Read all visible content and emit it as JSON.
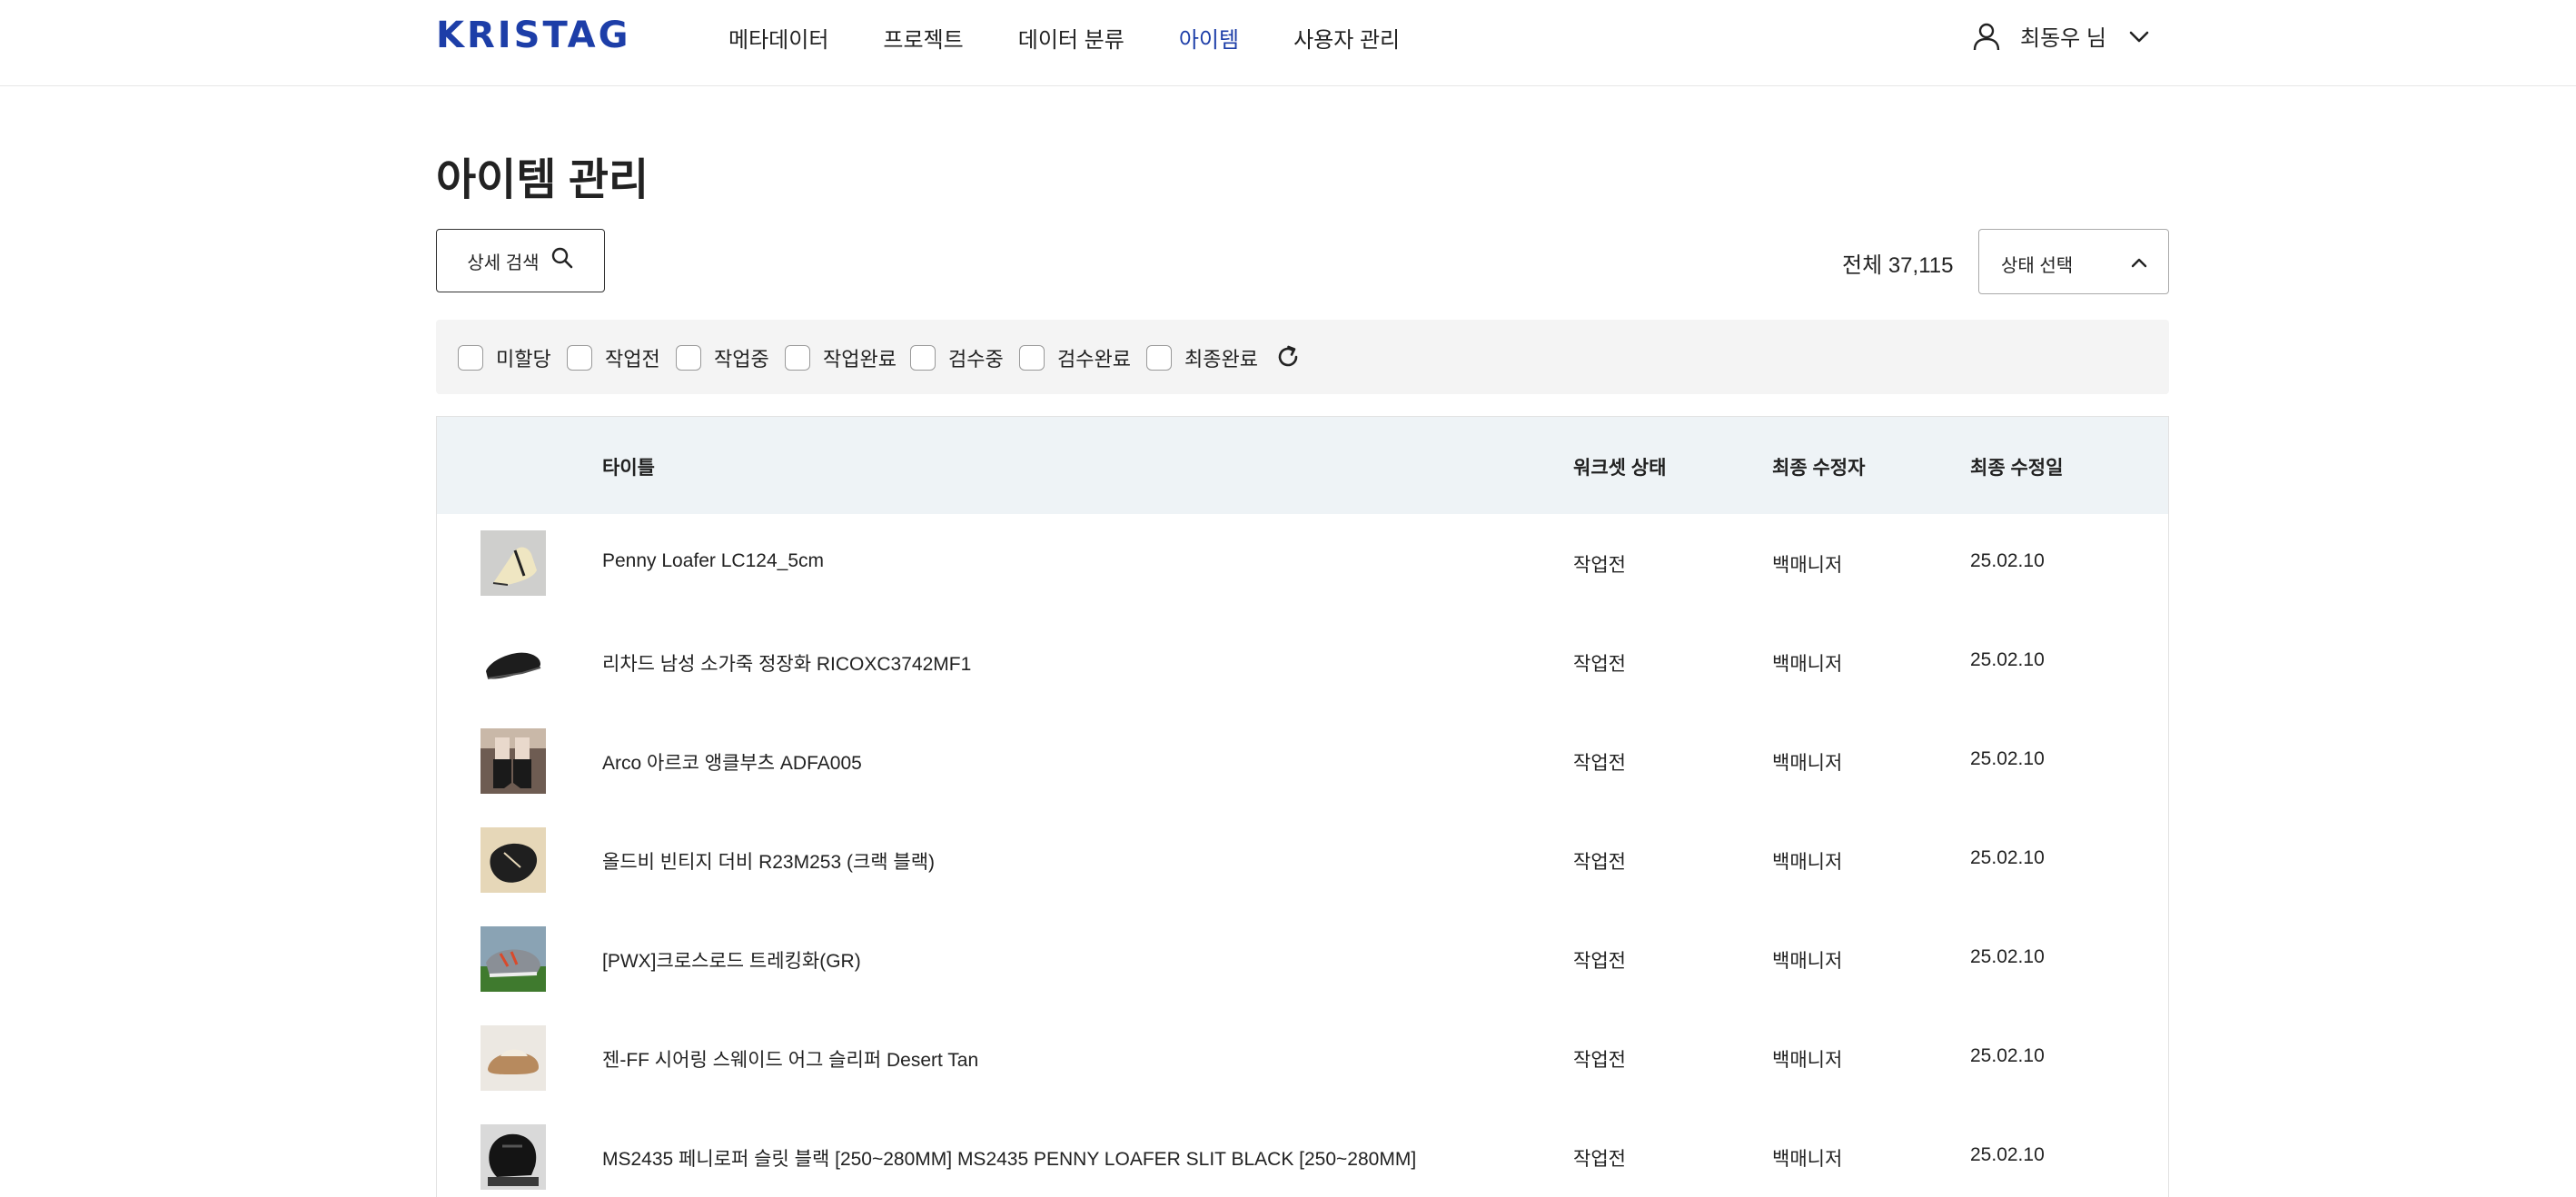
{
  "header": {
    "logo": "KRISTAG",
    "nav": [
      {
        "label": "메타데이터",
        "active": false
      },
      {
        "label": "프로젝트",
        "active": false
      },
      {
        "label": "데이터 분류",
        "active": false
      },
      {
        "label": "아이템",
        "active": true
      },
      {
        "label": "사용자 관리",
        "active": false
      }
    ],
    "user_name": "최동우 님",
    "accent_color": "#1d3ea8"
  },
  "page": {
    "title": "아이템 관리",
    "search_button": "상세 검색",
    "total_label": "전체 37,115",
    "status_select": "상태 선택"
  },
  "filters": [
    {
      "label": "미할당",
      "checked": false
    },
    {
      "label": "작업전",
      "checked": false
    },
    {
      "label": "작업중",
      "checked": false
    },
    {
      "label": "작업완료",
      "checked": false
    },
    {
      "label": "검수중",
      "checked": false
    },
    {
      "label": "검수완료",
      "checked": false
    },
    {
      "label": "최종완료",
      "checked": false
    }
  ],
  "table": {
    "headers": {
      "title": "타이틀",
      "status": "워크셋 상태",
      "modifier": "최종 수정자",
      "modified": "최종 수정일"
    },
    "rows": [
      {
        "title": "Penny Loafer LC124_5cm",
        "status": "작업전",
        "modifier": "백매니저",
        "modified": "25.02.10",
        "thumb": "cream-loafer"
      },
      {
        "title": "리차드 남성 소가죽 정장화 RICOXC3742MF1",
        "status": "작업전",
        "modifier": "백매니저",
        "modified": "25.02.10",
        "thumb": "black-oxford"
      },
      {
        "title": "Arco 아르코 앵클부츠 ADFA005",
        "status": "작업전",
        "modifier": "백매니저",
        "modified": "25.02.10",
        "thumb": "ankle-boots"
      },
      {
        "title": "올드비 빈티지 더비 R23M253 (크랙 블랙)",
        "status": "작업전",
        "modifier": "백매니저",
        "modified": "25.02.10",
        "thumb": "black-derby"
      },
      {
        "title": "[PWX]크로스로드 트레킹화(GR)",
        "status": "작업전",
        "modifier": "백매니저",
        "modified": "25.02.10",
        "thumb": "trekking-shoe"
      },
      {
        "title": "젠-FF 시어링 스웨이드 어그 슬리퍼 Desert Tan",
        "status": "작업전",
        "modifier": "백매니저",
        "modified": "25.02.10",
        "thumb": "suede-slipper"
      },
      {
        "title": "MS2435 페니로퍼 슬릿 블랙 [250~280MM] MS2435 PENNY LOAFER SLIT BLACK [250~280MM]",
        "status": "작업전",
        "modifier": "백매니저",
        "modified": "25.02.10",
        "thumb": "black-penny-loafer"
      }
    ]
  }
}
